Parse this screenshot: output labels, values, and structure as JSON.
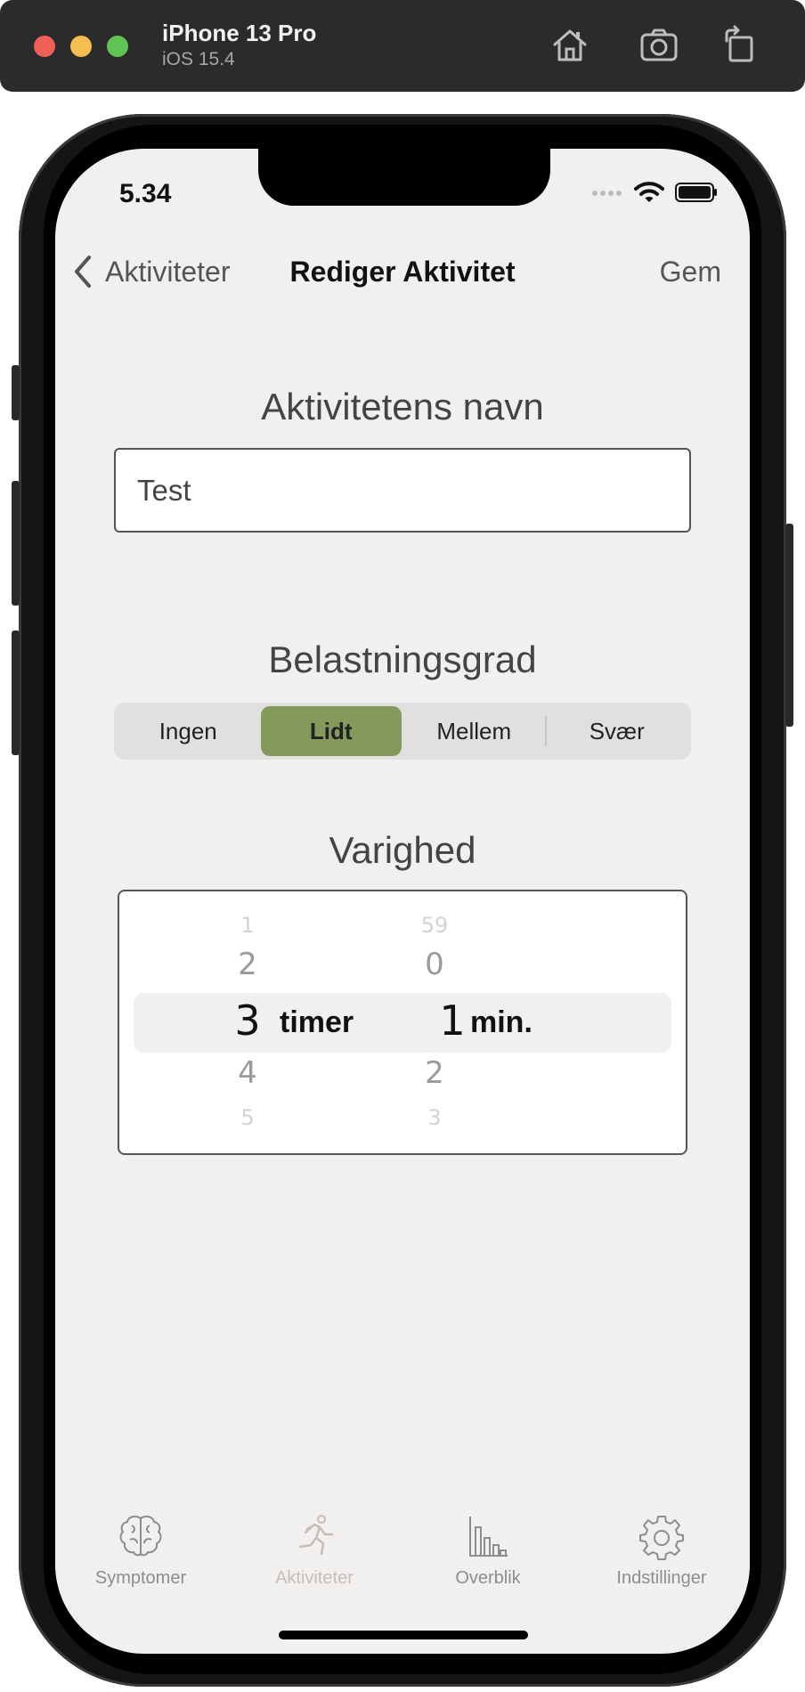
{
  "simulator": {
    "device_name": "iPhone 13 Pro",
    "os_version": "iOS 15.4"
  },
  "status_bar": {
    "time": "5.34"
  },
  "nav": {
    "back_label": "Aktiviteter",
    "title": "Rediger Aktivitet",
    "save_label": "Gem"
  },
  "name_section": {
    "title": "Aktivitetens navn",
    "value": "Test"
  },
  "load_section": {
    "title": "Belastningsgrad",
    "options": [
      "Ingen",
      "Lidt",
      "Mellem",
      "Svær"
    ],
    "selected": "Lidt"
  },
  "duration_section": {
    "title": "Varighed",
    "hours_wheel": [
      "1",
      "2",
      "3",
      "4",
      "5"
    ],
    "hours_selected": "3",
    "hours_unit": "timer",
    "minutes_wheel": [
      "59",
      "0",
      "1",
      "2",
      "3"
    ],
    "minutes_selected": "1",
    "minutes_unit": "min."
  },
  "tabs": [
    {
      "label": "Symptomer",
      "icon": "brain-icon"
    },
    {
      "label": "Aktiviteter",
      "icon": "running-person-icon",
      "active": true
    },
    {
      "label": "Overblik",
      "icon": "bar-chart-icon"
    },
    {
      "label": "Indstillinger",
      "icon": "gear-icon"
    }
  ],
  "colors": {
    "accent": "#849a5c",
    "screen_background": "#f1f0ef",
    "active_tab": "#c9bcb6"
  }
}
